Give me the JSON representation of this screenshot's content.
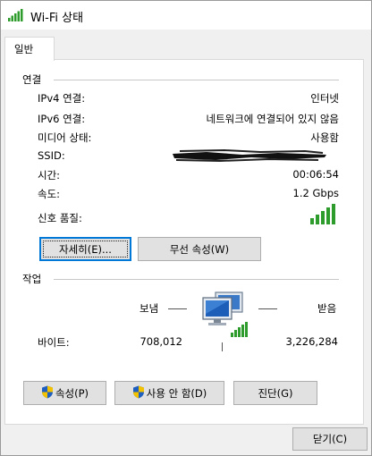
{
  "window": {
    "title": "Wi-Fi 상태",
    "icon": "wifi-signal-icon"
  },
  "tab": {
    "label": "일반"
  },
  "connection": {
    "section_label": "연결",
    "rows": [
      {
        "label": "IPv4 연결:",
        "value": "인터넷"
      },
      {
        "label": "IPv6 연결:",
        "value": "네트워크에 연결되어 있지 않음"
      },
      {
        "label": "미디어 상태:",
        "value": "사용함"
      },
      {
        "label": "SSID:",
        "value": ""
      },
      {
        "label": "시간:",
        "value": "00:06:54"
      },
      {
        "label": "속도:",
        "value": "1.2 Gbps"
      }
    ],
    "signal_label": "신호 품질:",
    "signal_bars": 5
  },
  "buttons": {
    "details": "자세히(E)...",
    "wireless_props": "무선 속성(W)"
  },
  "activity": {
    "section_label": "작업",
    "sent_label": "보냄",
    "received_label": "받음",
    "bytes_label": "바이트:",
    "bytes_sent": "708,012",
    "bytes_received": "3,226,284"
  },
  "actions": {
    "properties": "속성(P)",
    "disable": "사용 안 함(D)",
    "diagnose": "진단(G)"
  },
  "close": "닫기(C)",
  "colors": {
    "signal": "#2d9c2d",
    "focus": "#0078d7",
    "shield_blue": "#1f5fbf",
    "shield_yellow": "#f2c200"
  }
}
